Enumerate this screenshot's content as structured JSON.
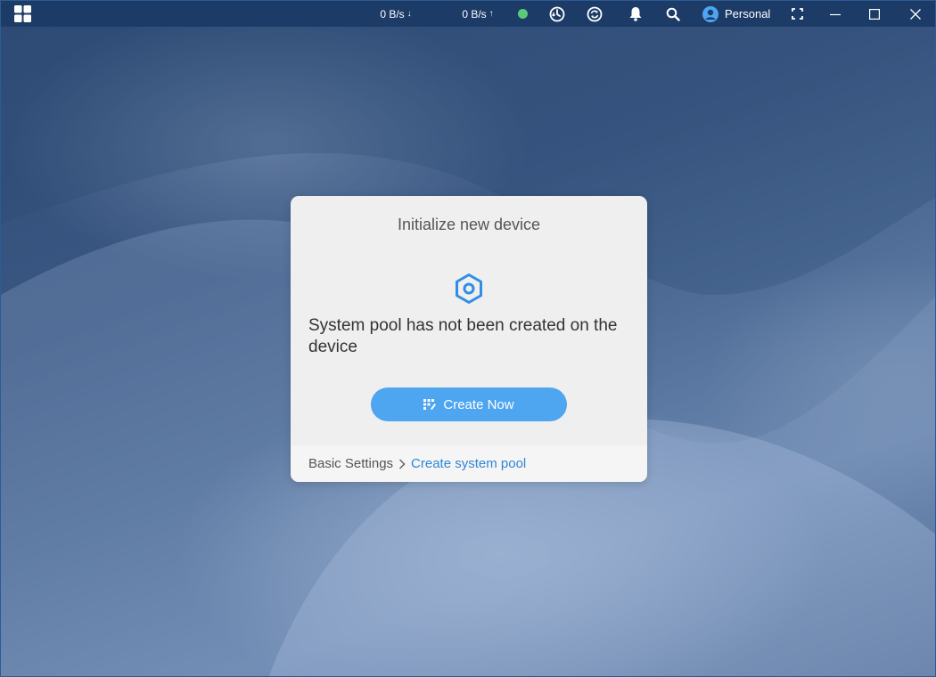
{
  "topbar": {
    "download_rate": "0 B/s",
    "upload_rate": "0 B/s",
    "download_arrow": "↓",
    "upload_arrow": "↑",
    "status_color": "#5cc97a",
    "user_name": "Personal",
    "icons": [
      "grid-menu-icon",
      "arrow-down-icon",
      "arrow-up-icon",
      "status-dot",
      "sync-clock-icon",
      "refresh-icon",
      "bell-icon",
      "search-icon",
      "user-avatar-icon",
      "fullscreen-icon",
      "minimize-icon",
      "maximize-icon",
      "close-icon"
    ]
  },
  "dialog": {
    "title": "Initialize new device",
    "message": "System pool has not been created on the device",
    "create_button": "Create Now",
    "accent_color": "#4ea5f0",
    "breadcrumb": {
      "basic": "Basic Settings",
      "current": "Create system pool"
    }
  }
}
